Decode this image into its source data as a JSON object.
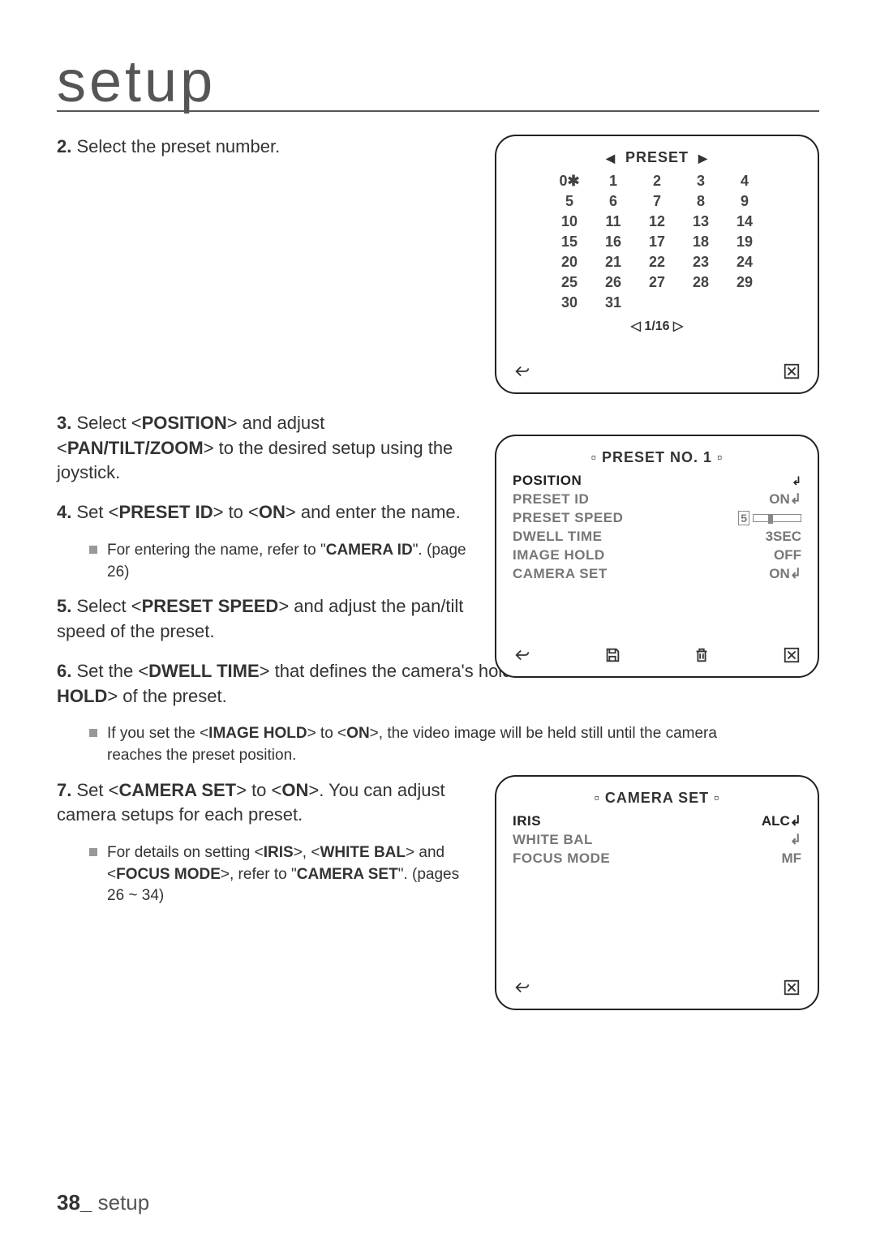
{
  "page": {
    "title": "setup",
    "footer_page": "38_",
    "footer_label": "setup"
  },
  "steps": {
    "s2": {
      "num": "2.",
      "text": "Select the preset number."
    },
    "s3": {
      "num": "3.",
      "pre": "Select <",
      "k1": "POSITION",
      "mid1": "> and adjust <",
      "k2": "PAN/TILT/ZOOM",
      "post": "> to the desired setup using the joystick."
    },
    "s4": {
      "num": "4.",
      "pre": "Set <",
      "k1": "PRESET ID",
      "mid1": "> to <",
      "k2": "ON",
      "post": "> and enter the name."
    },
    "s4note": {
      "pre": "For entering the name, refer to \"",
      "k1": "CAMERA ID",
      "post": "\". (page 26)"
    },
    "s5": {
      "num": "5.",
      "pre": "Select <",
      "k1": "PRESET SPEED",
      "post": "> and adjust the pan/tilt speed of the preset."
    },
    "s6": {
      "num": "6.",
      "pre": "Set the <",
      "k1": "DWELL TIME",
      "mid1": "> that defines the camera's hold duration and <",
      "k2": "IMAGE HOLD",
      "post": "> of the preset."
    },
    "s6note": {
      "pre": "If you set the <",
      "k1": "IMAGE HOLD",
      "mid1": "> to <",
      "k2": "ON",
      "post": ">, the video image will be held still until the camera reaches the preset position."
    },
    "s7": {
      "num": "7.",
      "pre": "Set <",
      "k1": "CAMERA SET",
      "mid1": "> to <",
      "k2": "ON",
      "post": ">. You can adjust camera setups for each preset."
    },
    "s7note": {
      "pre": "For details on setting <",
      "k1": "IRIS",
      "mid1": ">, <",
      "k2": "WHITE BAL",
      "mid2": "> and <",
      "k3": "FOCUS MODE",
      "mid3": ">, refer to \"",
      "k4": "CAMERA SET",
      "post": "\". (pages 26 ~ 34)"
    }
  },
  "screen1": {
    "title": "PRESET",
    "grid": [
      "0✱",
      "1",
      "2",
      "3",
      "4",
      "5",
      "6",
      "7",
      "8",
      "9",
      "10",
      "11",
      "12",
      "13",
      "14",
      "15",
      "16",
      "17",
      "18",
      "19",
      "20",
      "21",
      "22",
      "23",
      "24",
      "25",
      "26",
      "27",
      "28",
      "29",
      "30",
      "31"
    ],
    "pager": "◁ 1/16 ▷"
  },
  "screen2": {
    "title": "▫ PRESET NO. 1 ▫",
    "rows": {
      "r1": {
        "label": "POSITION",
        "val": "↲"
      },
      "r2": {
        "label": "PRESET ID",
        "val": "ON↲"
      },
      "r3": {
        "label": "PRESET SPEED",
        "num": "5"
      },
      "r4": {
        "label": "DWELL TIME",
        "val": "3SEC"
      },
      "r5": {
        "label": "IMAGE HOLD",
        "val": "OFF"
      },
      "r6": {
        "label": "CAMERA SET",
        "val": "ON↲"
      }
    }
  },
  "screen3": {
    "title": "▫ CAMERA SET ▫",
    "rows": {
      "r1": {
        "label": "IRIS",
        "val": "ALC↲"
      },
      "r2": {
        "label": "WHITE BAL",
        "val": "↲"
      },
      "r3": {
        "label": "FOCUS MODE",
        "val": "MF"
      }
    }
  }
}
